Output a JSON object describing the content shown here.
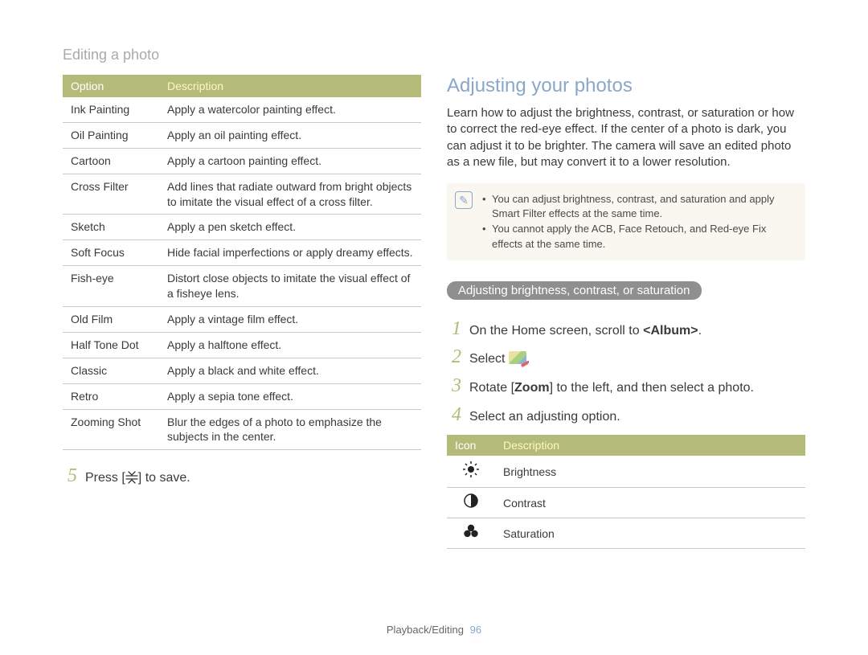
{
  "header": "Editing a photo",
  "table1": {
    "head": [
      "Option",
      "Description"
    ],
    "rows": [
      [
        "Ink Painting",
        "Apply a watercolor painting effect."
      ],
      [
        "Oil Painting",
        "Apply an oil painting effect."
      ],
      [
        "Cartoon",
        "Apply a cartoon painting effect."
      ],
      [
        "Cross Filter",
        "Add lines that radiate outward from bright objects to imitate the visual effect of a cross filter."
      ],
      [
        "Sketch",
        "Apply a pen sketch effect."
      ],
      [
        "Soft Focus",
        "Hide facial imperfections or apply dreamy effects."
      ],
      [
        "Fish-eye",
        "Distort close objects to imitate the visual effect of a fisheye lens."
      ],
      [
        "Old Film",
        "Apply a vintage film effect."
      ],
      [
        "Half Tone Dot",
        "Apply a halftone effect."
      ],
      [
        "Classic",
        "Apply a black and white effect."
      ],
      [
        "Retro",
        "Apply a sepia tone effect."
      ],
      [
        "Zooming Shot",
        "Blur the edges of a photo to emphasize the subjects in the center."
      ]
    ]
  },
  "step5_pre": "Press [",
  "step5_post": "] to save.",
  "right": {
    "title": "Adjusting your photos",
    "para": "Learn how to adjust the brightness, contrast, or saturation or how to correct the red-eye effect. If the center of a photo is dark, you can adjust it to be brighter. The camera will save an edited photo as a new file, but may convert it to a lower resolution.",
    "notes": [
      "You can adjust brightness, contrast, and saturation and apply Smart Filter effects at the same time.",
      "You cannot apply the ACB, Face Retouch, and Red-eye Fix effects at the same time."
    ],
    "pill": "Adjusting brightness, contrast, or saturation",
    "steps": {
      "s1_pre": "On the Home screen, scroll to ",
      "s1_strong": "<Album>",
      "s1_post": ".",
      "s2_pre": "Select ",
      "s2_post": ".",
      "s3_pre": "Rotate [",
      "s3_bold": "Zoom",
      "s3_post": "] to the left, and then select a photo.",
      "s4": "Select an adjusting option."
    },
    "table2": {
      "head": [
        "Icon",
        "Description"
      ],
      "rows": [
        {
          "glyph": "☀",
          "label": "Brightness"
        },
        {
          "glyph": "◐",
          "label": "Contrast"
        },
        {
          "glyph": "⚫⚫⚫",
          "label": "Saturation",
          "is_sat": true
        }
      ]
    }
  },
  "footer": {
    "section": "Playback/Editing",
    "page": "96"
  }
}
